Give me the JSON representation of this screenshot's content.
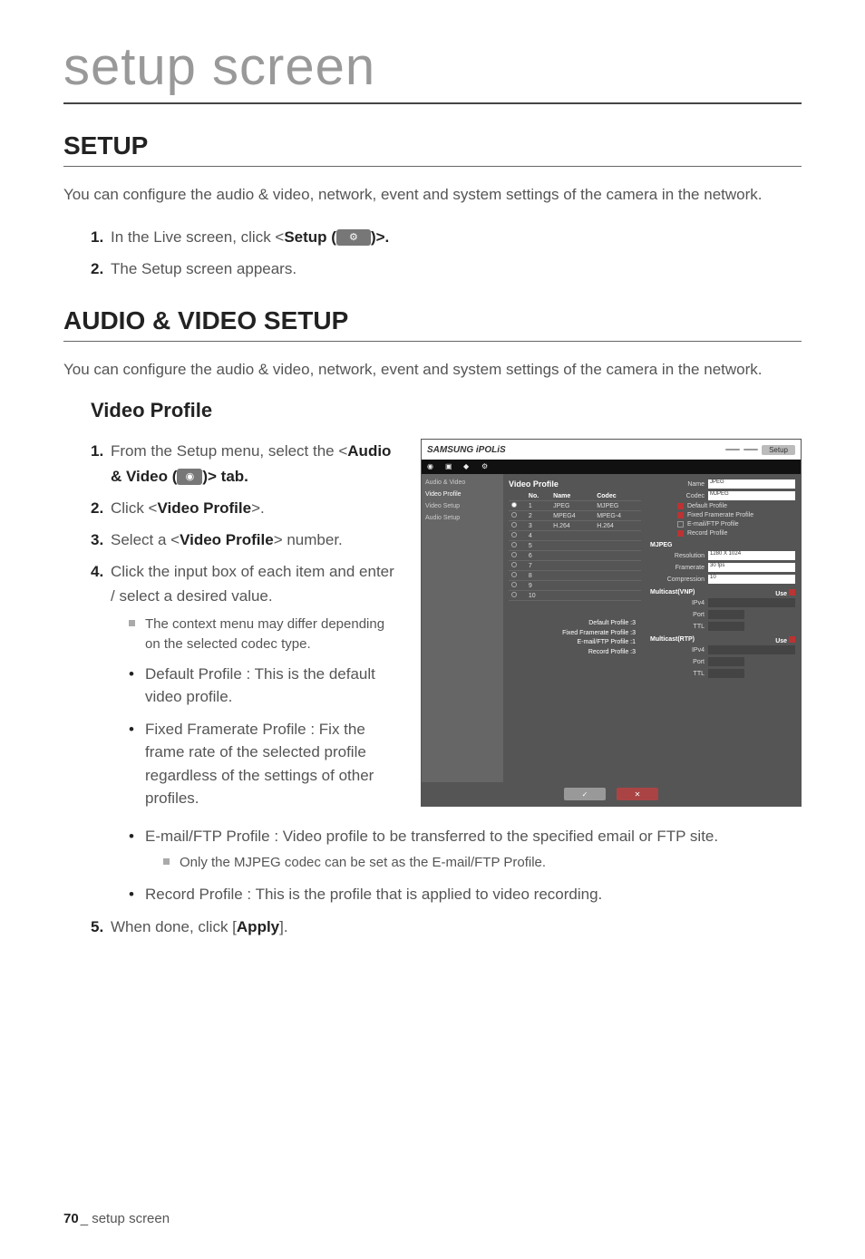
{
  "page": {
    "main_title": "setup screen",
    "footer_page": "70",
    "footer_sep": "_",
    "footer_label": "setup screen"
  },
  "section1": {
    "heading": "SETUP",
    "intro": "You can configure the audio & video, network, event and system settings of the camera in the network.",
    "steps": [
      {
        "num": "1.",
        "pre": "In the Live screen, click <",
        "bold": "Setup (",
        "icon": true,
        "post": ")>."
      },
      {
        "num": "2.",
        "text": "The Setup screen appears."
      }
    ]
  },
  "section2": {
    "heading": "AUDIO & VIDEO SETUP",
    "intro": "You can configure the audio & video, network, event and system settings of the camera in the network.",
    "sub_heading": "Video Profile",
    "steps": {
      "s1": {
        "num": "1.",
        "pre": "From the Setup menu, select the <",
        "bold1": "Audio & Video (",
        "post1": ")> tab."
      },
      "s2": {
        "num": "2.",
        "pre": "Click <",
        "bold": "Video Profile",
        "post": ">."
      },
      "s3": {
        "num": "3.",
        "pre": "Select a <",
        "bold": "Video Profile",
        "post": "> number."
      },
      "s4": {
        "num": "4.",
        "text": "Click the input box of each item and enter / select a desired value."
      },
      "s4_sq": "The context menu may differ depending on the selected codec type.",
      "s4_b1": "Default Profile : This is the default video profile.",
      "s4_b2": "Fixed Framerate Profile : Fix the frame rate of the selected profile regardless of the settings of other profiles.",
      "s4_b3": "E-mail/FTP Profile : Video profile to be transferred to the specified email or FTP site.",
      "s4_b3_sq": "Only the MJPEG codec can be set as the E-mail/FTP Profile.",
      "s4_b4": "Record Profile : This is the profile that is applied to video recording.",
      "s5": {
        "num": "5.",
        "pre": "When done, click [",
        "bold": "Apply",
        "post": "]."
      }
    }
  },
  "screenshot": {
    "logo": "SAMSUNG iPOLiS",
    "tab_setup": "Setup",
    "tab_live": " ",
    "tab_play": " ",
    "side": {
      "cat": "Audio & Video",
      "i1": "Video Profile",
      "i2": "Video Setup",
      "i3": "Audio Setup"
    },
    "tbl": {
      "title": "Video Profile",
      "h_no": "No.",
      "h_name": "Name",
      "h_codec": "Codec",
      "rows": [
        {
          "no": "1",
          "name": "JPEG",
          "codec": "MJPEG",
          "sel": true
        },
        {
          "no": "2",
          "name": "MPEG4",
          "codec": "MPEG-4",
          "sel": false
        },
        {
          "no": "3",
          "name": "H.264",
          "codec": "H.264",
          "sel": false
        },
        {
          "no": "4",
          "name": "",
          "codec": "",
          "sel": false
        },
        {
          "no": "5",
          "name": "",
          "codec": "",
          "sel": false
        },
        {
          "no": "6",
          "name": "",
          "codec": "",
          "sel": false
        },
        {
          "no": "7",
          "name": "",
          "codec": "",
          "sel": false
        },
        {
          "no": "8",
          "name": "",
          "codec": "",
          "sel": false
        },
        {
          "no": "9",
          "name": "",
          "codec": "",
          "sel": false
        },
        {
          "no": "10",
          "name": "",
          "codec": "",
          "sel": false
        }
      ],
      "p1": "Default Profile :3",
      "p2": "Fixed Framerate Profile :3",
      "p3": "E-mail/FTP Profile :1",
      "p4": "Record Profile :3"
    },
    "right": {
      "name_l": "Name",
      "name_v": "JPEG",
      "codec_l": "Codec",
      "codec_v": "MJPEG",
      "chk1": "Default Profile",
      "chk2": "Fixed Framerate Profile",
      "chk3": "E-mail/FTP Profile",
      "chk4": "Record Profile",
      "g1": "MJPEG",
      "res_l": "Resolution",
      "res_v": "1280 X 1024",
      "fr_l": "Framerate",
      "fr_v": "30 fps",
      "comp_l": "Compression",
      "comp_v": "10",
      "g2": "Multicast(VNP)",
      "g2_use": "Use",
      "ip_l": "IPv4",
      "port_l": "Port",
      "ttl_l": "TTL",
      "g3": "Multicast(RTP)",
      "g3_use": "Use"
    },
    "btn_apply": "✓",
    "btn_cancel": "✕"
  }
}
